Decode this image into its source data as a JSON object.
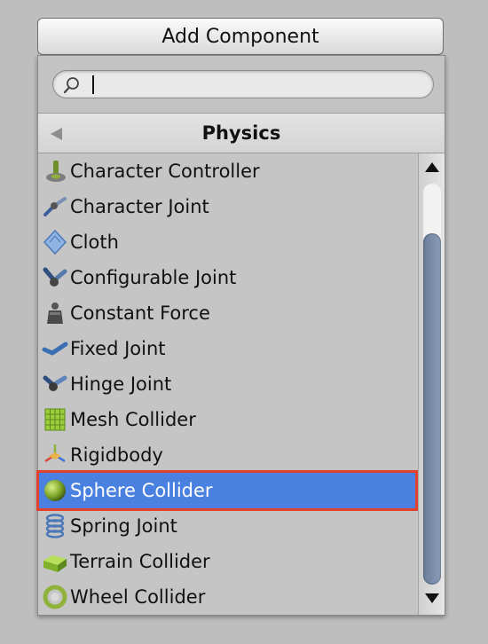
{
  "add_component": {
    "label": "Add Component"
  },
  "search": {
    "value": ""
  },
  "header": {
    "title": "Physics"
  },
  "items": [
    {
      "label": "Character Controller",
      "icon": "character-controller-icon"
    },
    {
      "label": "Character Joint",
      "icon": "character-joint-icon"
    },
    {
      "label": "Cloth",
      "icon": "cloth-icon"
    },
    {
      "label": "Configurable Joint",
      "icon": "configurable-joint-icon"
    },
    {
      "label": "Constant Force",
      "icon": "constant-force-icon"
    },
    {
      "label": "Fixed Joint",
      "icon": "fixed-joint-icon"
    },
    {
      "label": "Hinge Joint",
      "icon": "hinge-joint-icon"
    },
    {
      "label": "Mesh Collider",
      "icon": "mesh-collider-icon"
    },
    {
      "label": "Rigidbody",
      "icon": "rigidbody-icon"
    },
    {
      "label": "Sphere Collider",
      "icon": "sphere-collider-icon",
      "selected": true
    },
    {
      "label": "Spring Joint",
      "icon": "spring-joint-icon"
    },
    {
      "label": "Terrain Collider",
      "icon": "terrain-collider-icon"
    },
    {
      "label": "Wheel Collider",
      "icon": "wheel-collider-icon"
    }
  ],
  "colors": {
    "selection": "#4a80df",
    "highlight_outline": "#e2412d"
  }
}
